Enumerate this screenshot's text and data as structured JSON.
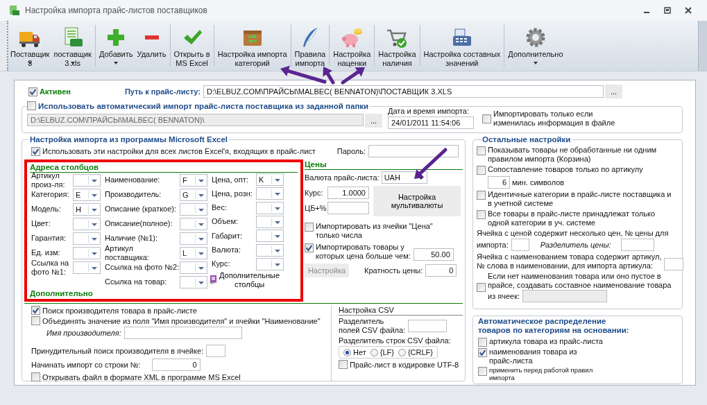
{
  "window": {
    "title": "Настройка импорта прайс-листов поставщиков"
  },
  "toolbar": [
    [
      {
        "label": "Поставщик\n3",
        "kind": "truck",
        "dropdown": true
      },
      {
        "label": "поставщик\n3.xls",
        "kind": "sheet",
        "dropdown": true
      }
    ],
    [
      {
        "label": "Добавить",
        "kind": "plus",
        "dropdown": true
      },
      {
        "label": "Удалить",
        "kind": "minus",
        "dropdown": false
      }
    ],
    [
      {
        "label": "Открыть в\nMS Excel",
        "kind": "check",
        "dropdown": false
      }
    ],
    [
      {
        "label": "Настройка импорта\nкатегорий",
        "kind": "box",
        "dropdown": false
      }
    ],
    [
      {
        "label": "Правила\nимпорта",
        "kind": "quill",
        "dropdown": false
      }
    ],
    [
      {
        "label": "Настройка\nнаценки",
        "kind": "pig",
        "dropdown": false
      }
    ],
    [
      {
        "label": "Настройка\nналичия",
        "kind": "cart",
        "dropdown": false
      }
    ],
    [
      {
        "label": "Настройка составных\nзначений",
        "kind": "register",
        "dropdown": false
      }
    ],
    [
      {
        "label": "Дополнительно",
        "kind": "gear",
        "dropdown": true
      }
    ]
  ],
  "active": {
    "label": "Активен",
    "checked": true
  },
  "path": {
    "label": "Путь к прайс-листу:",
    "value": "D:\\ELBUZ.COM\\ПРАЙСЫ\\MALBEC( BENNATON)\\ПОСТАВЩИК 3.XLS",
    "button": "..."
  },
  "auto_import": {
    "label": "Использовать автоматический импорт прайс-листа поставщика из заданной папки",
    "checked": false,
    "path": "D:\\ELBUZ.COM\\ПРАЙСЫ\\MALBEC( BENNATON)\\",
    "button": "...",
    "date_label": "Дата и время импорта:",
    "date": "24/01/2011 11:54:06",
    "only_changed": {
      "label": "Импортировать только если\nизменилась информация в файле",
      "checked": false
    }
  },
  "excel": {
    "title": "Настройка импорта из программы Microsoft Excel",
    "all_sheets": {
      "label": "Использовать эти настройки для всех листов Excel'я, входящих в прайс-лист",
      "checked": true
    },
    "password_label": "Пароль:",
    "columns_title": "Адреса столбцов",
    "columns": [
      [
        {
          "label": "Артикул\nпроиз-ля:"
        },
        {
          "label": "Категория:",
          "value": "E"
        },
        {
          "label": "Модель:",
          "value": "H"
        },
        {
          "label": "Цвет:"
        },
        {
          "label": "Гарантия:"
        },
        {
          "label": "Ед. изм:"
        },
        {
          "label": "Ссылка на\nфото №1:"
        }
      ],
      [
        {
          "label": "Наименование:",
          "value": "F"
        },
        {
          "label": "Производитель:",
          "value": "G"
        },
        {
          "label": "Описание (краткое):"
        },
        {
          "label": "Описание(полное):"
        },
        {
          "label": "Наличие (№1):"
        },
        {
          "label": "Артикул\nпоставщика:",
          "value": "L"
        },
        {
          "label": "Ссылка на фото №2:"
        },
        {
          "label": "Ссылка на товар:"
        }
      ],
      [
        {
          "label": "Цена, опт:",
          "value": "K"
        },
        {
          "label": "Цена, розн:"
        },
        {
          "label": "Вес:"
        },
        {
          "label": "Объем:"
        },
        {
          "label": "Габарит:"
        },
        {
          "label": "Валюта:"
        },
        {
          "label": "Курс:"
        }
      ]
    ],
    "extra_columns": "Дополнительные\nстолбцы",
    "prices": {
      "title": "Цены",
      "currency_label": "Валюта прайс-листа:",
      "currency": "UAH",
      "rate_label": "Курс:",
      "rate": "1.0000",
      "cb_label": "ЦБ+%",
      "multi_button": "Настройка\nмультивалюты",
      "numbers_only": {
        "label": "Импортировать из ячейки \"Цена\"\nтолько числа",
        "checked": false
      },
      "min_price": {
        "label": "Импортировать товары у\nкоторых цена больше чем:",
        "checked": true,
        "value": "50.00"
      },
      "setup_button": {
        "label": "Настройка",
        "disabled": true
      },
      "multiple_label": "Кратность цены:",
      "multiple": "0"
    },
    "more_title": "Дополнительно",
    "more": {
      "search_maker": {
        "label": "Поиск производителя товара в прайс-листе",
        "checked": true
      },
      "merge": {
        "label": "Объединять значение из поля \"Имя производителя\" и ячейки \"Наименование\"",
        "checked": false
      },
      "maker_name_label": "Имя производителя:",
      "force_label": "Принудительный поиск производителя в ячейке:",
      "start_label": "Начинать импорт со строки №:",
      "start": "0",
      "xml": {
        "label": "Открывать файл в формате XML в программе MS Excel",
        "checked": false
      }
    },
    "csv": {
      "title": "Настройка CSV",
      "field_sep_label": "Разделитель\nполей CSV файла:",
      "row_sep_label": "Разделитель строк CSV файла:",
      "row_seps": [
        {
          "label": "Нет",
          "selected": true
        },
        {
          "label": "{LF}",
          "selected": false
        },
        {
          "label": "{CRLF}",
          "selected": false
        }
      ],
      "utf8": {
        "label": "Прайс-лист в кодировке UTF-8",
        "checked": false
      }
    }
  },
  "other": {
    "title": "Остальные настройки",
    "show_unprocessed": {
      "label": "Показывать товары не обработанные ни одним\nправилом импорта (Корзина)",
      "checked": false
    },
    "sku_only": {
      "label": "Сопоставление товаров только по артикулу",
      "checked": false
    },
    "min_chars": "6",
    "min_chars_label": "мин. символов",
    "same_categories": {
      "label": "Идентичные категории в прайс-листе поставщика и\nв учетной системе",
      "checked": false
    },
    "one_category": {
      "label": "Все товары в прайс-листе принадлежат только\nодной категории в уч. системе",
      "checked": false
    },
    "multi_price_label": [
      "Ячейка с ценой содержит несколько цен, № цены для",
      "импорта:"
    ],
    "price_sep_label": "Разделитель цены:",
    "sku_in_name_label": "Ячейка с наименованием товара содержит артикул,\n№ слова в наименовании, для импорта артикула:",
    "compose_name": {
      "label": [
        "Если нет наименования товара или оно пустое в\nпрайсе, создавать составное наименование товара",
        "из ячеек:"
      ],
      "checked": false
    }
  },
  "auto_dist": {
    "title": "Автоматическое распределение\nтоваров по категориям на основании:",
    "items": [
      {
        "label": "артикула товара из прайс-листа",
        "checked": false,
        "kind": "normal"
      },
      {
        "label": "наименования товара из\nпрайс-листа",
        "checked": true,
        "kind": "normal"
      },
      {
        "label": "применить перед работой правил\nимпорта",
        "checked": false,
        "kind": "small"
      }
    ]
  }
}
